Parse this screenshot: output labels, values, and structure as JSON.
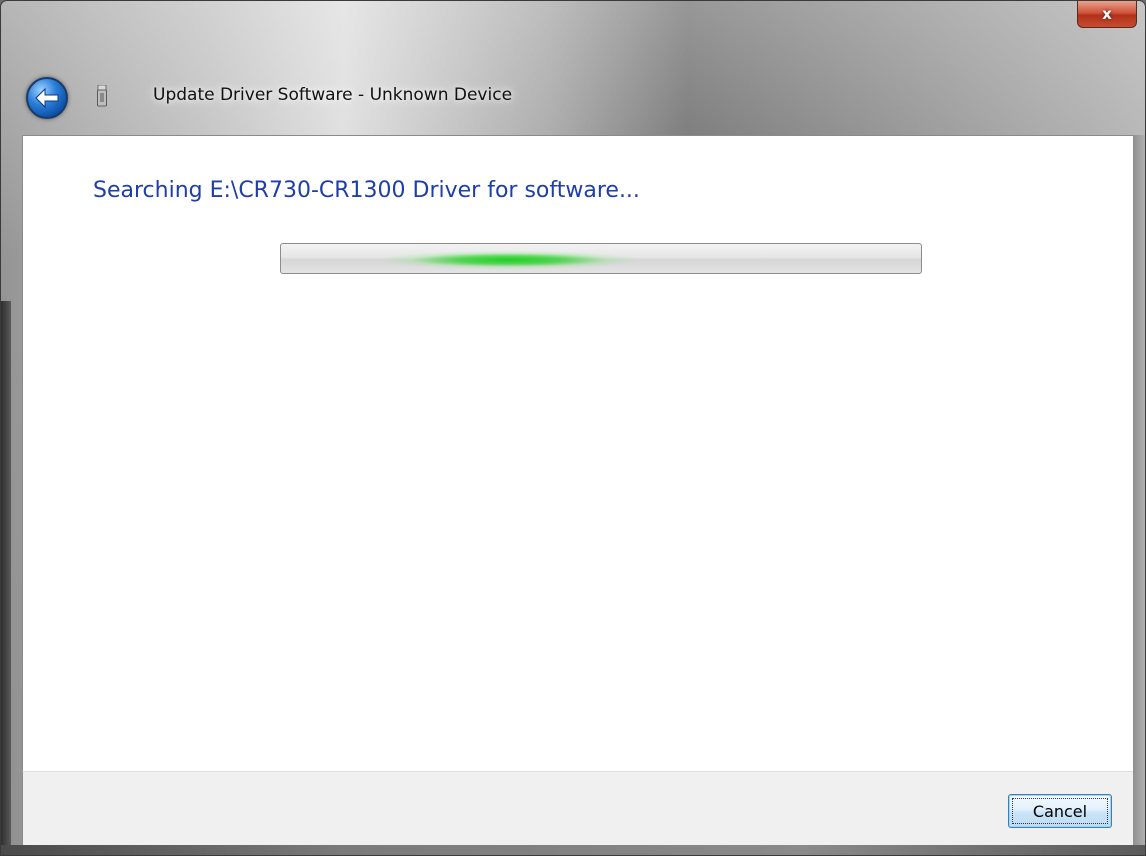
{
  "window": {
    "title": "Update Driver Software - Unknown Device",
    "close_label": "x"
  },
  "icons": {
    "back": "back-arrow-icon",
    "device": "usb-device-icon",
    "close": "close-icon"
  },
  "main": {
    "heading": "Searching E:\\CR730-CR1300 Driver for software...",
    "progress_state": "indeterminate"
  },
  "footer": {
    "cancel_label": "Cancel"
  },
  "colors": {
    "heading": "#1e3ea8",
    "progress_glow": "#20d020",
    "close_button": "#c94b2e"
  }
}
